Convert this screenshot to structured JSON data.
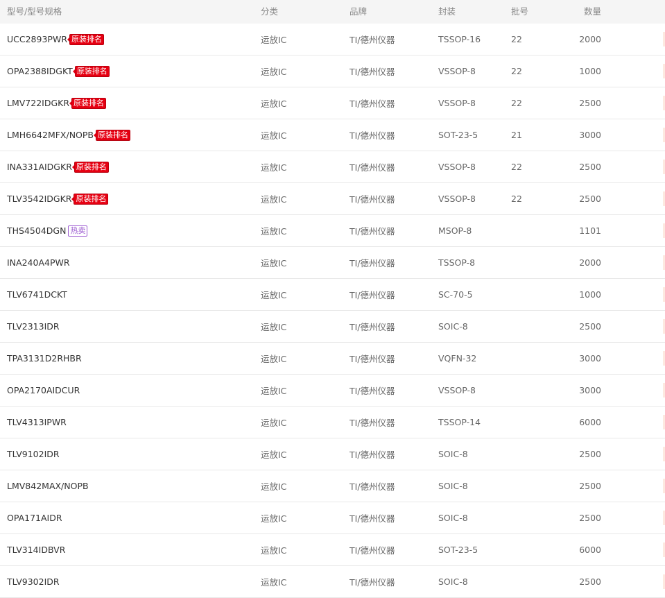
{
  "header": {
    "model": "型号/型号规格",
    "category": "分类",
    "brand": "品牌",
    "package": "封装",
    "batch": "批号",
    "quantity": "数量"
  },
  "rows": [
    {
      "model": "UCC2893PWR",
      "tag": "原装排名",
      "tag_type": "red",
      "category": "运放IC",
      "brand": "TI/德州仪器",
      "package": "TSSOP-16",
      "batch": "22",
      "quantity": "2000"
    },
    {
      "model": "OPA2388IDGKT",
      "tag": "原装排名",
      "tag_type": "red",
      "category": "运放IC",
      "brand": "TI/德州仪器",
      "package": "VSSOP-8",
      "batch": "22",
      "quantity": "1000"
    },
    {
      "model": "LMV722IDGKR",
      "tag": "原装排名",
      "tag_type": "red",
      "category": "运放IC",
      "brand": "TI/德州仪器",
      "package": "VSSOP-8",
      "batch": "22",
      "quantity": "2500"
    },
    {
      "model": "LMH6642MFX/NOPB",
      "tag": "原装排名",
      "tag_type": "red",
      "category": "运放IC",
      "brand": "TI/德州仪器",
      "package": "SOT-23-5",
      "batch": "21",
      "quantity": "3000"
    },
    {
      "model": "INA331AIDGKR",
      "tag": "原装排名",
      "tag_type": "red",
      "category": "运放IC",
      "brand": "TI/德州仪器",
      "package": "VSSOP-8",
      "batch": "22",
      "quantity": "2500"
    },
    {
      "model": "TLV3542IDGKR",
      "tag": "原装排名",
      "tag_type": "red",
      "category": "运放IC",
      "brand": "TI/德州仪器",
      "package": "VSSOP-8",
      "batch": "22",
      "quantity": "2500"
    },
    {
      "model": "THS4504DGN",
      "tag": "热卖",
      "tag_type": "hot",
      "category": "运放IC",
      "brand": "TI/德州仪器",
      "package": "MSOP-8",
      "batch": "",
      "quantity": "1101"
    },
    {
      "model": "INA240A4PWR",
      "tag": "",
      "tag_type": "",
      "category": "运放IC",
      "brand": "TI/德州仪器",
      "package": "TSSOP-8",
      "batch": "",
      "quantity": "2000"
    },
    {
      "model": "TLV6741DCKT",
      "tag": "",
      "tag_type": "",
      "category": "运放IC",
      "brand": "TI/德州仪器",
      "package": "SC-70-5",
      "batch": "",
      "quantity": "1000"
    },
    {
      "model": "TLV2313IDR",
      "tag": "",
      "tag_type": "",
      "category": "运放IC",
      "brand": "TI/德州仪器",
      "package": "SOIC-8",
      "batch": "",
      "quantity": "2500"
    },
    {
      "model": "TPA3131D2RHBR",
      "tag": "",
      "tag_type": "",
      "category": "运放IC",
      "brand": "TI/德州仪器",
      "package": "VQFN-32",
      "batch": "",
      "quantity": "3000"
    },
    {
      "model": "OPA2170AIDCUR",
      "tag": "",
      "tag_type": "",
      "category": "运放IC",
      "brand": "TI/德州仪器",
      "package": "VSSOP-8",
      "batch": "",
      "quantity": "3000"
    },
    {
      "model": "TLV4313IPWR",
      "tag": "",
      "tag_type": "",
      "category": "运放IC",
      "brand": "TI/德州仪器",
      "package": "TSSOP-14",
      "batch": "",
      "quantity": "6000"
    },
    {
      "model": "TLV9102IDR",
      "tag": "",
      "tag_type": "",
      "category": "运放IC",
      "brand": "TI/德州仪器",
      "package": "SOIC-8",
      "batch": "",
      "quantity": "2500"
    },
    {
      "model": "LMV842MAX/NOPB",
      "tag": "",
      "tag_type": "",
      "category": "运放IC",
      "brand": "TI/德州仪器",
      "package": "SOIC-8",
      "batch": "",
      "quantity": "2500"
    },
    {
      "model": "OPA171AIDR",
      "tag": "",
      "tag_type": "",
      "category": "运放IC",
      "brand": "TI/德州仪器",
      "package": "SOIC-8",
      "batch": "",
      "quantity": "2500"
    },
    {
      "model": "TLV314IDBVR",
      "tag": "",
      "tag_type": "",
      "category": "运放IC",
      "brand": "TI/德州仪器",
      "package": "SOT-23-5",
      "batch": "",
      "quantity": "6000"
    },
    {
      "model": "TLV9302IDR",
      "tag": "",
      "tag_type": "",
      "category": "运放IC",
      "brand": "TI/德州仪器",
      "package": "SOIC-8",
      "batch": "",
      "quantity": "2500"
    }
  ]
}
